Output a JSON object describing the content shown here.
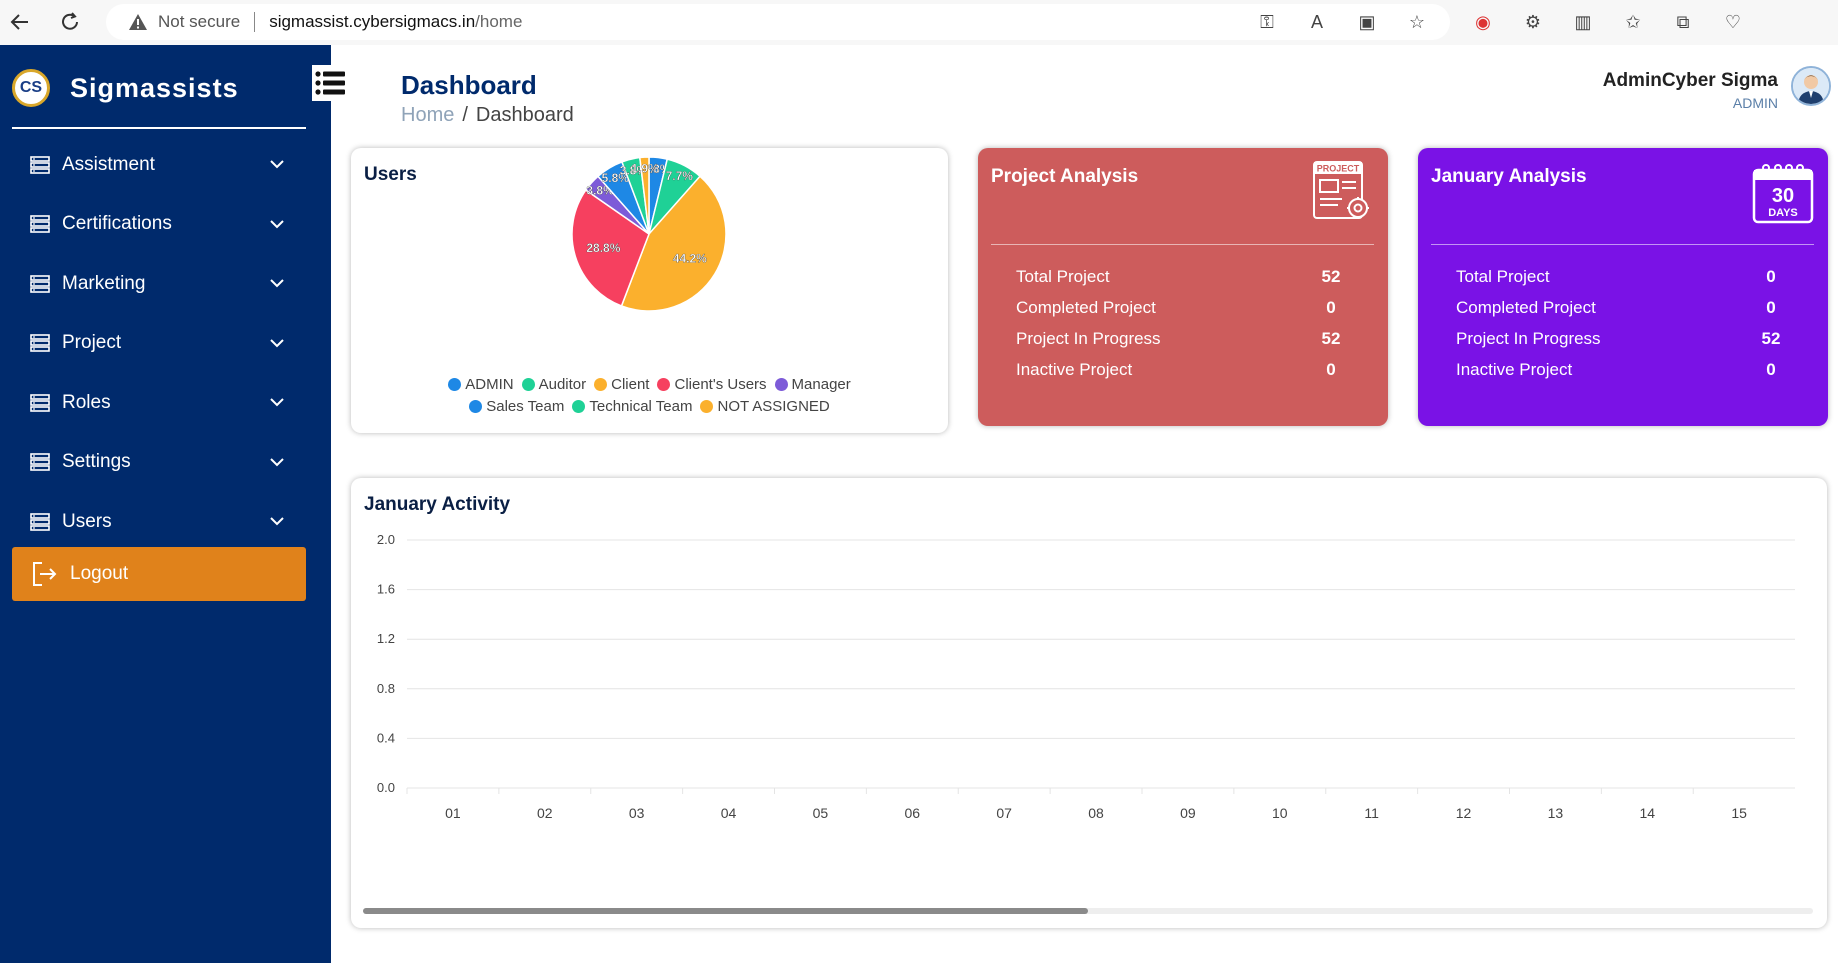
{
  "browser": {
    "not_secure": "Not secure",
    "url_host": "sigmassist.cybersigmacs.in",
    "url_path": "/home"
  },
  "sidebar": {
    "brand": "Sigmassists",
    "logo_text": "CS",
    "items": [
      {
        "label": "Assistment"
      },
      {
        "label": "Certifications"
      },
      {
        "label": "Marketing"
      },
      {
        "label": "Project"
      },
      {
        "label": "Roles"
      },
      {
        "label": "Settings"
      },
      {
        "label": "Users"
      }
    ],
    "logout": "Logout",
    "color": "#002a6c",
    "logout_color": "#e0821b"
  },
  "header": {
    "title": "Dashboard",
    "breadcrumb_home": "Home",
    "breadcrumb_sep": "/",
    "breadcrumb_current": "Dashboard",
    "user_name": "AdminCyber Sigma",
    "user_role": "ADMIN"
  },
  "users_card": {
    "title": "Users",
    "legend": [
      {
        "label": "ADMIN",
        "color": "#1e88e5"
      },
      {
        "label": "Auditor",
        "color": "#1fd196"
      },
      {
        "label": "Client",
        "color": "#fbb02d"
      },
      {
        "label": "Client's Users",
        "color": "#f6405f"
      },
      {
        "label": "Manager",
        "color": "#7d5bd8"
      },
      {
        "label": "Sales Team",
        "color": "#1e88e5"
      },
      {
        "label": "Technical Team",
        "color": "#1fd196"
      },
      {
        "label": "NOT ASSIGNED",
        "color": "#fbb02d"
      }
    ]
  },
  "project_analysis": {
    "title": "Project Analysis",
    "icon_text": "PROJECT",
    "color": "#cd5c5c",
    "rows": [
      {
        "label": "Total Project",
        "value": "52"
      },
      {
        "label": "Completed Project",
        "value": "0"
      },
      {
        "label": "Project In Progress",
        "value": "52"
      },
      {
        "label": "Inactive Project",
        "value": "0"
      }
    ]
  },
  "january_analysis": {
    "title": "January Analysis",
    "icon_number": "30",
    "icon_text": "DAYS",
    "color": "#7a12e6",
    "rows": [
      {
        "label": "Total Project",
        "value": "0"
      },
      {
        "label": "Completed Project",
        "value": "0"
      },
      {
        "label": "Project In Progress",
        "value": "52"
      },
      {
        "label": "Inactive Project",
        "value": "0"
      }
    ]
  },
  "activity": {
    "title": "January Activity",
    "scroll_fraction": 0.5
  },
  "chart_data": [
    {
      "type": "pie",
      "title": "Users",
      "slices": [
        {
          "label": "ADMIN",
          "value": 3.8,
          "color": "#1e88e5",
          "label_text": "3.8%"
        },
        {
          "label": "Auditor",
          "value": 7.7,
          "color": "#1fd196",
          "label_text": "7.7%"
        },
        {
          "label": "Client",
          "value": 44.2,
          "color": "#fbb02d",
          "label_text": "44.2%"
        },
        {
          "label": "Client's Users",
          "value": 28.8,
          "color": "#f6405f",
          "label_text": "28.8%"
        },
        {
          "label": "Manager",
          "value": 3.8,
          "color": "#7d5bd8",
          "label_text": "3.8%"
        },
        {
          "label": "Sales Team",
          "value": 5.8,
          "color": "#1e88e5",
          "label_text": "5.8%"
        },
        {
          "label": "Technical Team",
          "value": 3.8,
          "color": "#1fd196",
          "label_text": "3.8%"
        },
        {
          "label": "NOT ASSIGNED",
          "value": 1.9,
          "color": "#fbb02d",
          "label_text": "1.9%"
        }
      ]
    },
    {
      "type": "bar",
      "title": "January Activity",
      "categories": [
        "01",
        "02",
        "03",
        "04",
        "05",
        "06",
        "07",
        "08",
        "09",
        "10",
        "11",
        "12",
        "13",
        "14",
        "15"
      ],
      "series": [
        {
          "values": [
            0,
            0,
            0,
            0,
            0,
            0,
            0,
            0,
            0,
            0,
            0,
            0,
            0,
            0,
            0
          ]
        }
      ],
      "ylim": [
        0,
        2.0
      ],
      "yticks": [
        "0.0",
        "0.4",
        "0.8",
        "1.2",
        "1.6",
        "2.0"
      ],
      "grid": true
    }
  ]
}
